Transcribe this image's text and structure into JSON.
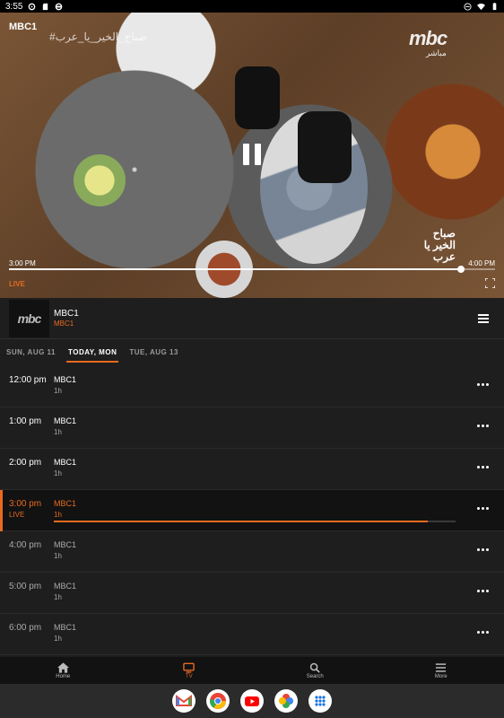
{
  "status_bar": {
    "time": "3:55"
  },
  "player": {
    "channel_label": "MBC1",
    "hashtag": "#صباح_الخير_يا_عرب",
    "logo_text": "mbc",
    "logo_subtitle": "مباشر",
    "show_logo_text": "صباح الخير يا عرب",
    "start_time": "3:00 PM",
    "end_time": "4:00 PM",
    "progress": 0.93,
    "live_label": "LIVE"
  },
  "channel_header": {
    "name": "MBC1",
    "subtitle": "MBC1",
    "thumb_text": "mbc"
  },
  "date_tabs": [
    {
      "label": "SUN, AUG 11",
      "active": false
    },
    {
      "label": "TODAY, MON",
      "active": true
    },
    {
      "label": "TUE, AUG 13",
      "active": false
    }
  ],
  "schedule": [
    {
      "time": "12:00 pm",
      "title": "MBC1",
      "duration": "1h",
      "state": "past"
    },
    {
      "time": "1:00 pm",
      "title": "MBC1",
      "duration": "1h",
      "state": "past"
    },
    {
      "time": "2:00 pm",
      "title": "MBC1",
      "duration": "1h",
      "state": "past"
    },
    {
      "time": "3:00 pm",
      "live": "LIVE",
      "title": "MBC1",
      "duration": "1h",
      "state": "current",
      "progress": 0.93
    },
    {
      "time": "4:00 pm",
      "title": "MBC1",
      "duration": "1h",
      "state": "future"
    },
    {
      "time": "5:00 pm",
      "title": "MBC1",
      "duration": "1h",
      "state": "future"
    },
    {
      "time": "6:00 pm",
      "title": "MBC1",
      "duration": "1h",
      "state": "future"
    }
  ],
  "bottom_nav": [
    {
      "label": "Home",
      "icon": "home-icon",
      "active": false
    },
    {
      "label": "TV",
      "icon": "tv-icon",
      "active": true
    },
    {
      "label": "Search",
      "icon": "search-icon",
      "active": false
    },
    {
      "label": "More",
      "icon": "menu-icon",
      "active": false
    }
  ],
  "taskbar_apps": [
    "gmail-icon",
    "chrome-icon",
    "youtube-icon",
    "photos-icon",
    "app-drawer-icon"
  ],
  "colors": {
    "accent": "#e86a1f",
    "background": "#1e1e1e"
  }
}
